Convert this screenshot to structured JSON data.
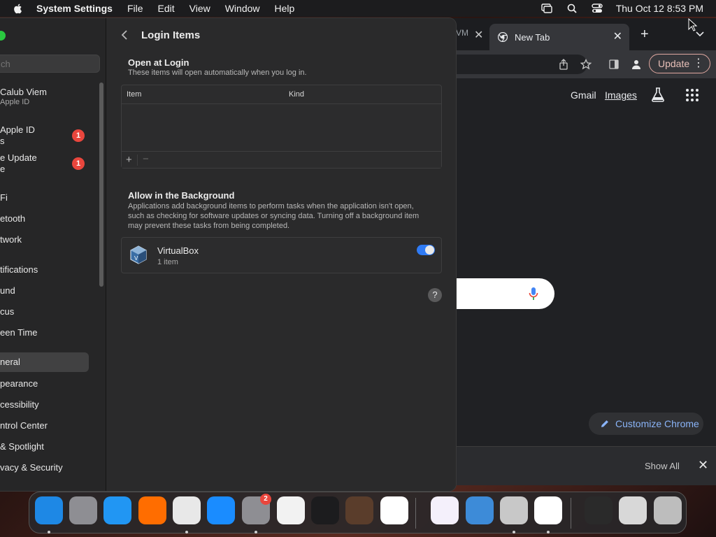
{
  "menubar": {
    "app_name": "System Settings",
    "menus": [
      "File",
      "Edit",
      "View",
      "Window",
      "Help"
    ],
    "clock": "Thu Oct 12  8:53 PM"
  },
  "settings": {
    "sidebar": {
      "search_placeholder": "ch",
      "user_name": "Calub Viem",
      "user_sub": "Apple ID",
      "notices": [
        {
          "line1": "Apple ID",
          "line2": "s",
          "badge": "1"
        },
        {
          "line1": "e Update",
          "line2": "e",
          "badge": "1"
        }
      ],
      "items": [
        "Fi",
        "etooth",
        "twork",
        "tifications",
        "und",
        "cus",
        "een Time",
        "neral",
        "pearance",
        "cessibility",
        "ntrol Center",
        "& Spotlight",
        "vacy & Security"
      ],
      "selected_item": "neral"
    },
    "main": {
      "title": "Login Items",
      "open_at_login": {
        "title": "Open at Login",
        "description": "These items will open automatically when you log in.",
        "columns": [
          "Item",
          "Kind"
        ],
        "add_label": "+",
        "remove_label": "−"
      },
      "background": {
        "title": "Allow in the Background",
        "description": "Applications add background items to perform tasks when the application isn't open, such as checking for software updates or syncing data. Turning off a background item may prevent these tasks from being completed.",
        "items": [
          {
            "name": "VirtualBox",
            "count": "1 item",
            "enabled": true
          }
        ]
      },
      "help_label": "?"
    }
  },
  "chrome": {
    "old_tab_fragment": "VM",
    "active_tab": "New Tab",
    "update_label": "Update",
    "links": {
      "gmail": "Gmail",
      "images": "Images"
    },
    "customize_label": "Customize Chrome",
    "downloads": {
      "show_all": "Show All"
    }
  },
  "dock": {
    "items": [
      {
        "name": "finder",
        "color": "#1e88e5",
        "running": true
      },
      {
        "name": "launchpad",
        "color": "#8e8e93",
        "running": false
      },
      {
        "name": "safari",
        "color": "#2196f3",
        "running": false
      },
      {
        "name": "firefox",
        "color": "#ff6d00",
        "running": false
      },
      {
        "name": "chrome",
        "color": "#e8e8e8",
        "running": true
      },
      {
        "name": "app-store",
        "color": "#1a8cff",
        "running": false
      },
      {
        "name": "system-settings",
        "color": "#8e8e93",
        "running": true,
        "badge": "2"
      },
      {
        "name": "textedit",
        "color": "#f2f2f2",
        "running": false
      },
      {
        "name": "terminal",
        "color": "#1c1c1e",
        "running": false
      },
      {
        "name": "garageband",
        "color": "#5a3d2b",
        "running": false
      },
      {
        "name": "vscode",
        "color": "#ffffff",
        "running": false
      },
      {
        "name": "visual-studio",
        "color": "#f4f0fb",
        "running": false
      },
      {
        "name": "weather",
        "color": "#3d8bd8",
        "running": false
      },
      {
        "name": "installer",
        "color": "#c8c8c8",
        "running": true
      },
      {
        "name": "freeform",
        "color": "#ffffff",
        "running": true
      },
      {
        "name": "downloads-stack",
        "color": "#2a2a2a",
        "running": false
      },
      {
        "name": "virtualbox-stack",
        "color": "#d8d8d8",
        "running": false
      },
      {
        "name": "trash",
        "color": "#bdbdbd",
        "running": false
      }
    ]
  }
}
